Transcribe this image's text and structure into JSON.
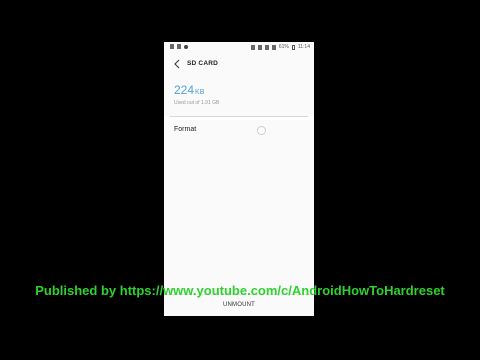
{
  "status_bar": {
    "battery": "61%",
    "time": "11:14"
  },
  "app_bar": {
    "title": "SD CARD"
  },
  "storage": {
    "used_value": "224",
    "used_unit": "KB",
    "subtitle": "Used out of 1.91 GB"
  },
  "format": {
    "label": "Format"
  },
  "bottom": {
    "unmount_label": "UNMOUNT"
  },
  "watermark": {
    "text": "Published by https://www.youtube.com/c/AndroidHowToHardreset"
  },
  "colors": {
    "accent": "#4ca3d7",
    "watermark": "#2fd12f"
  }
}
